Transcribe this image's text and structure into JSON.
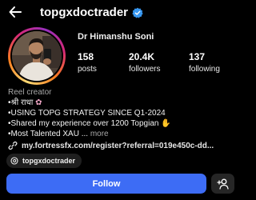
{
  "header": {
    "username": "topgxdoctrader",
    "verified": true
  },
  "profile": {
    "display_name": "Dr Himanshu Soni",
    "stats": {
      "posts": {
        "count": "158",
        "label": "posts"
      },
      "followers": {
        "count": "20.4K",
        "label": "followers"
      },
      "following": {
        "count": "137",
        "label": "following"
      }
    },
    "category": "Reel creator",
    "bio": {
      "line1": "•श्री राधा",
      "line2": "•USING TOPG STRATEGY SINCE Q1-2024",
      "line3": "•Shared my experience over 1200 Topgian",
      "line4": "•Most Talented XAU ...",
      "more_label": "more"
    },
    "link": "my.fortressfx.com/register?referral=019e450c-dd...",
    "threads_handle": "topgxdoctrader"
  },
  "actions": {
    "follow_label": "Follow"
  },
  "colors": {
    "background": "#000000",
    "follow_button": "#3d6cf5",
    "secondary_button": "#262626",
    "verified_badge": "#3897f0"
  },
  "icons": {
    "back": "arrow-left-icon",
    "verified": "verified-badge-icon",
    "link": "link-icon",
    "threads": "threads-icon",
    "suggest": "add-person-icon"
  }
}
